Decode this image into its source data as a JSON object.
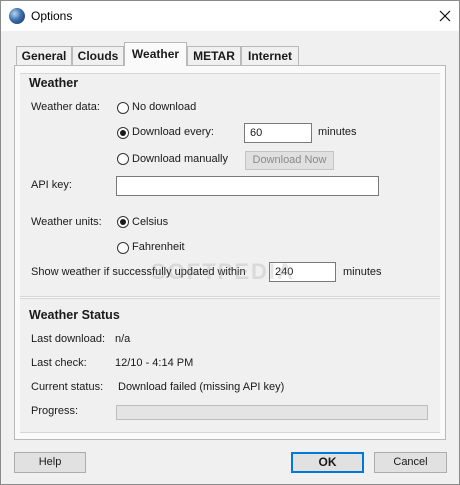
{
  "window": {
    "title": "Options",
    "close_glyph": "close-icon"
  },
  "tabs": [
    {
      "label": "General",
      "active": false
    },
    {
      "label": "Clouds",
      "active": false
    },
    {
      "label": "Weather",
      "active": true
    },
    {
      "label": "METAR",
      "active": false
    },
    {
      "label": "Internet",
      "active": false
    }
  ],
  "weather": {
    "heading": "Weather",
    "data_label": "Weather data:",
    "opt_no_download": "No download",
    "opt_download_every": "Download every:",
    "download_every_value": "60",
    "minutes_label": "minutes",
    "opt_download_manually": "Download manually",
    "download_now_button": "Download Now",
    "selected_data_option": "download_every",
    "api_key_label": "API key:",
    "api_key_value": "",
    "units_label": "Weather units:",
    "opt_celsius": "Celsius",
    "opt_fahrenheit": "Fahrenheit",
    "selected_unit": "celsius",
    "show_if_label": "Show weather if successfully updated within",
    "show_if_value": "240",
    "show_if_unit": "minutes"
  },
  "status": {
    "heading": "Weather Status",
    "last_download_label": "Last download:",
    "last_download_value": "n/a",
    "last_check_label": "Last check:",
    "last_check_value": "12/10 - 4:14 PM",
    "current_status_label": "Current status:",
    "current_status_value": "Download failed (missing API key)",
    "progress_label": "Progress:",
    "progress_value": 0
  },
  "watermark": "SOFTPEDIA",
  "buttons": {
    "help": "Help",
    "ok": "OK",
    "cancel": "Cancel"
  }
}
